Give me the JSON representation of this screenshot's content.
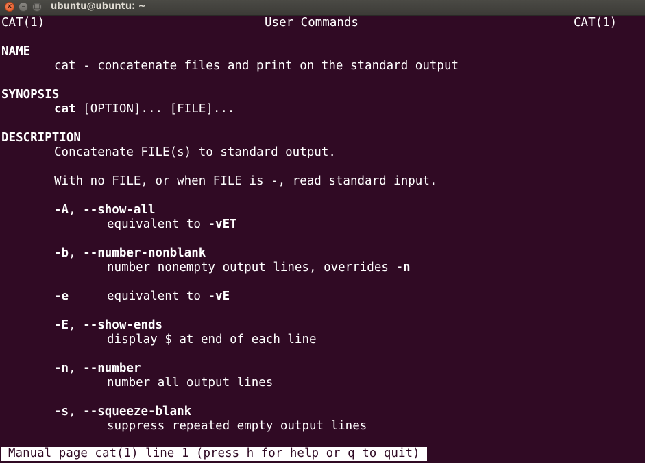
{
  "window": {
    "title": "ubuntu@ubuntu: ~",
    "close_glyph": "×",
    "minimize_glyph": "–",
    "maximize_glyph": "□"
  },
  "man": {
    "header_left": "CAT(1)",
    "header_center": "User Commands",
    "header_right": "CAT(1)",
    "name_heading": "NAME",
    "name_text": "cat - concatenate files and print on the standard output",
    "synopsis_heading": "SYNOPSIS",
    "synopsis": {
      "cmd": "cat",
      "sp1": " [",
      "option": "OPTION",
      "dots1": "]... [",
      "file": "FILE",
      "dots2": "]..."
    },
    "description_heading": "DESCRIPTION",
    "desc_line1": "Concatenate FILE(s) to standard output.",
    "desc_line2": "With no FILE, or when FILE is -, read standard input.",
    "options": [
      {
        "flag": "-A",
        "sep": ", ",
        "long": "--show-all",
        "desc_pre": "equivalent to ",
        "desc_bold": "-vET",
        "desc_post": ""
      },
      {
        "flag": "-b",
        "sep": ", ",
        "long": "--number-nonblank",
        "desc_pre": "number nonempty output lines, overrides ",
        "desc_bold": "-n",
        "desc_post": ""
      },
      {
        "flag": "-e",
        "desc_pre": "equivalent to ",
        "desc_bold": "-vE"
      },
      {
        "flag": "-E",
        "sep": ", ",
        "long": "--show-ends",
        "desc_pre": "display $ at end of each line"
      },
      {
        "flag": "-n",
        "sep": ", ",
        "long": "--number",
        "desc_pre": "number all output lines"
      },
      {
        "flag": "-s",
        "sep": ", ",
        "long": "--squeeze-blank",
        "desc_pre": "suppress repeated empty output lines"
      }
    ]
  },
  "status_line": "Manual page cat(1) line 1 (press h for help or q to quit)"
}
